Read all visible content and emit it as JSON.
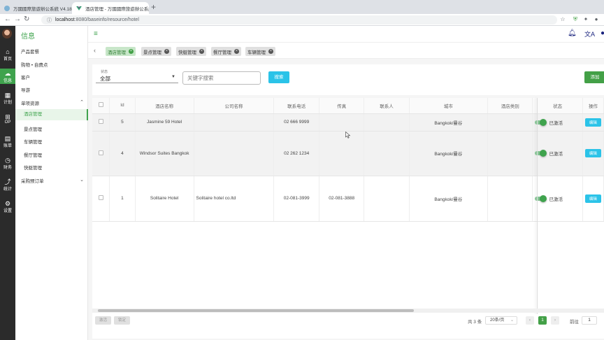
{
  "browser": {
    "tabs": [
      {
        "title": "万國國際旅遊辦公系統 V4.18"
      },
      {
        "title": "酒店管理 - 万國國際旅遊辦公系統"
      }
    ],
    "url_host": "localhost",
    "url_path": ":8080/baseinfo/resource/hotel"
  },
  "darkbar": {
    "items": [
      {
        "label": "首页",
        "icon": "home-icon"
      },
      {
        "label": "信息",
        "icon": "cloud-icon"
      },
      {
        "label": "计划",
        "icon": "calendar-icon"
      },
      {
        "label": "OP",
        "icon": "grid-icon"
      },
      {
        "label": "账单",
        "icon": "bill-icon"
      },
      {
        "label": "财务",
        "icon": "finance-icon"
      },
      {
        "label": "统计",
        "icon": "chart-icon"
      },
      {
        "label": "设置",
        "icon": "gear-icon"
      }
    ]
  },
  "sidebar": {
    "title": "信息",
    "items": [
      {
        "label": "产品套餐"
      },
      {
        "label": "购物 • 自费点"
      },
      {
        "label": "客户"
      },
      {
        "label": "导游"
      },
      {
        "label": "单项资源"
      },
      {
        "label": "酒店管理"
      },
      {
        "label": "景点管理"
      },
      {
        "label": "车辆管理"
      },
      {
        "label": "餐厅管理"
      },
      {
        "label": "快艇管理"
      },
      {
        "label": "采购预订单"
      }
    ]
  },
  "tags": [
    {
      "label": "酒店管理",
      "active": true
    },
    {
      "label": "景点管理",
      "active": false
    },
    {
      "label": "快艇管理",
      "active": false
    },
    {
      "label": "餐厅管理",
      "active": false
    },
    {
      "label": "车辆管理",
      "active": false
    }
  ],
  "filter": {
    "status_label": "状态",
    "status_value": "全部",
    "keyword_placeholder": "关键字搜索",
    "search_label": "搜索",
    "add_label": "添加"
  },
  "table": {
    "columns": [
      "Id",
      "酒店名称",
      "公司名称",
      "联系电话",
      "传真",
      "联系人",
      "城市",
      "酒店类别",
      "状态",
      "操作"
    ],
    "rows": [
      {
        "id": "5",
        "hotel": "Jasmine 59 Hotel",
        "company": "",
        "phone": "02 666 9999",
        "fax": "",
        "contact": "",
        "city": "Bangkok/曼谷",
        "category": "",
        "status": "已激活",
        "action": "编辑"
      },
      {
        "id": "4",
        "hotel": "Windsor Suites Bangkok",
        "company": "",
        "phone": "02 262 1234",
        "fax": "",
        "contact": "",
        "city": "Bangkok/曼谷",
        "category": "",
        "status": "已激活",
        "action": "编辑"
      },
      {
        "id": "1",
        "hotel": "Solitaire Hotel",
        "company": "Solitaire hotel co.ltd",
        "phone": "02-081-3999",
        "fax": "02-081-3888",
        "contact": "",
        "city": "Bangkok/曼谷",
        "category": "",
        "status": "已激活",
        "action": "编辑"
      }
    ]
  },
  "footer": {
    "btn_activate": "激活",
    "btn_lock": "锁定",
    "total": "共 3 条",
    "page_size": "20条/页",
    "current_page": "1",
    "goto_label": "前往",
    "goto_value": "1"
  },
  "colors": {
    "accent": "#3fa34d",
    "info": "#2bc3e8"
  }
}
